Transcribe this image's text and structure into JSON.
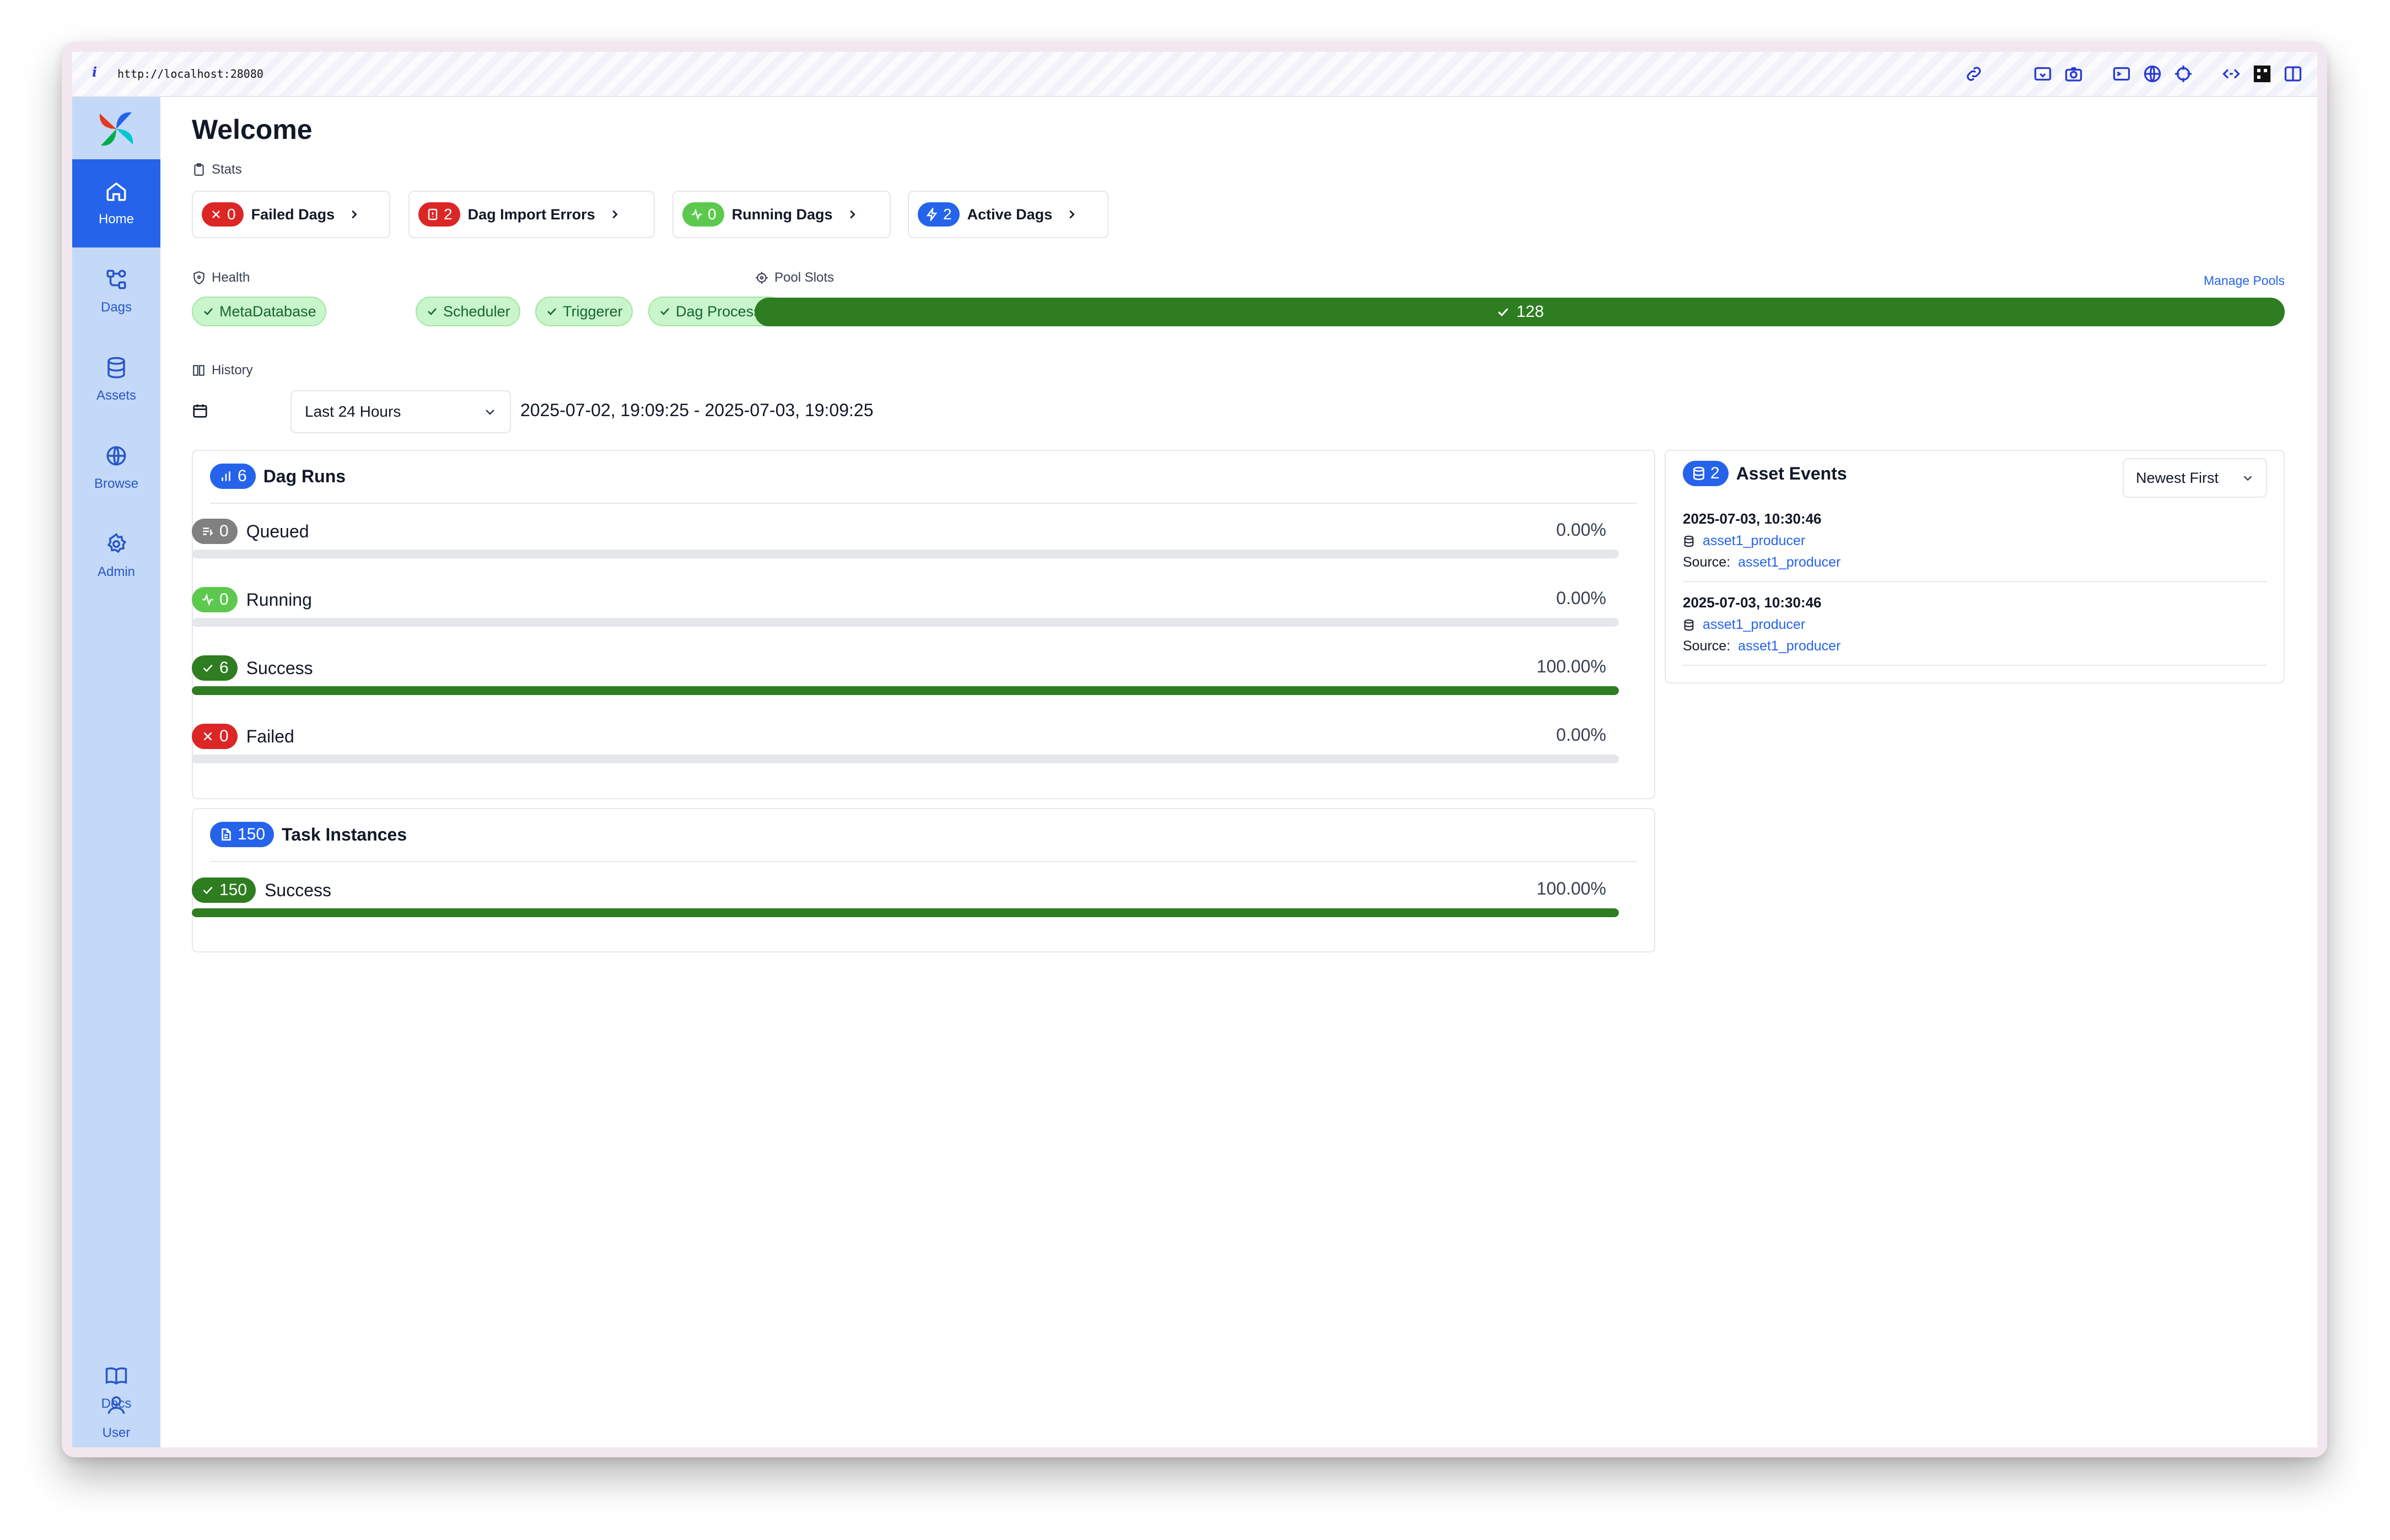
{
  "browser": {
    "url": "http://localhost:28080",
    "info_icon": "i"
  },
  "sidebar": {
    "items": [
      {
        "label": "Home",
        "icon": "home-icon"
      },
      {
        "label": "Dags",
        "icon": "dags-icon"
      },
      {
        "label": "Assets",
        "icon": "database-icon"
      },
      {
        "label": "Browse",
        "icon": "globe-icon"
      },
      {
        "label": "Admin",
        "icon": "gear-icon"
      },
      {
        "label": "Docs",
        "icon": "book-icon"
      },
      {
        "label": "User",
        "icon": "user-icon"
      }
    ]
  },
  "page": {
    "title": "Welcome"
  },
  "stats": {
    "label": "Stats",
    "cards": [
      {
        "count": "0",
        "label": "Failed Dags",
        "color": "#dc2626"
      },
      {
        "count": "2",
        "label": "Dag Import Errors",
        "color": "#dc2626"
      },
      {
        "count": "0",
        "label": "Running Dags",
        "color": "#5cc94e"
      },
      {
        "count": "2",
        "label": "Active Dags",
        "color": "#2563eb"
      }
    ]
  },
  "health": {
    "label": "Health",
    "items": [
      "MetaDatabase",
      "Scheduler",
      "Triggerer",
      "Dag Processor"
    ]
  },
  "pool_slots": {
    "label": "Pool Slots",
    "value": "128",
    "manage_link": "Manage Pools"
  },
  "history": {
    "label": "History",
    "range_select": "Last 24 Hours",
    "date_range": "2025-07-02, 19:09:25 - 2025-07-03, 19:09:25"
  },
  "dag_runs": {
    "count": "6",
    "title": "Dag Runs",
    "states": [
      {
        "count": "0",
        "label": "Queued",
        "pct": "0.00%",
        "fraction": 0.0,
        "color": "#808080"
      },
      {
        "count": "0",
        "label": "Running",
        "pct": "0.00%",
        "fraction": 0.0,
        "color": "#5cc94e"
      },
      {
        "count": "6",
        "label": "Success",
        "pct": "100.00%",
        "fraction": 1.0,
        "color": "#2e7d20"
      },
      {
        "count": "0",
        "label": "Failed",
        "pct": "0.00%",
        "fraction": 0.0,
        "color": "#dc2626"
      }
    ]
  },
  "task_instances": {
    "count": "150",
    "title": "Task Instances",
    "states": [
      {
        "count": "150",
        "label": "Success",
        "pct": "100.00%",
        "fraction": 1.0,
        "color": "#2e7d20"
      }
    ]
  },
  "asset_events": {
    "count": "2",
    "title": "Asset Events",
    "sort": "Newest First",
    "events": [
      {
        "time": "2025-07-03, 10:30:46",
        "asset": "asset1_producer",
        "source_label": "Source:",
        "source": "asset1_producer"
      },
      {
        "time": "2025-07-03, 10:30:46",
        "asset": "asset1_producer",
        "source_label": "Source:",
        "source": "asset1_producer"
      }
    ]
  }
}
